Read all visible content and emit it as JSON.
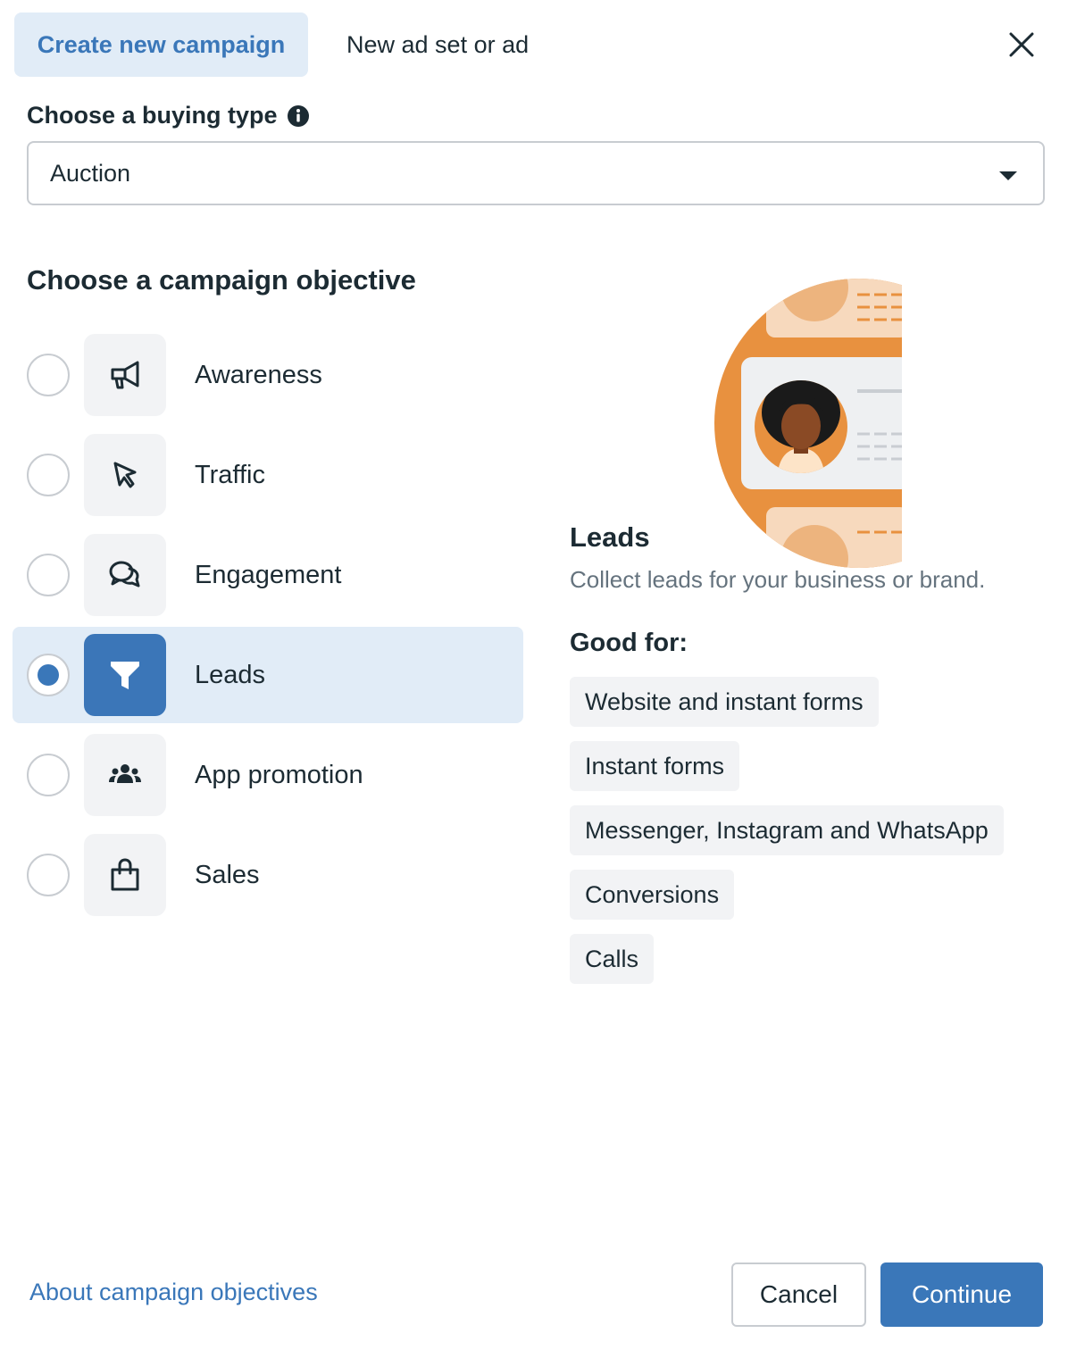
{
  "tabs": {
    "active": "Create new campaign",
    "inactive": "New ad set or ad"
  },
  "close_icon": "close-icon",
  "buying_type": {
    "label": "Choose a buying type",
    "info_icon": "info-icon",
    "selected": "Auction"
  },
  "objective": {
    "title": "Choose a campaign objective",
    "options": [
      {
        "label": "Awareness",
        "icon": "megaphone-icon",
        "selected": false
      },
      {
        "label": "Traffic",
        "icon": "cursor-icon",
        "selected": false
      },
      {
        "label": "Engagement",
        "icon": "chat-bubbles-icon",
        "selected": false
      },
      {
        "label": "Leads",
        "icon": "funnel-icon",
        "selected": true
      },
      {
        "label": "App promotion",
        "icon": "people-icon",
        "selected": false
      },
      {
        "label": "Sales",
        "icon": "shopping-bag-icon",
        "selected": false
      }
    ]
  },
  "detail": {
    "title": "Leads",
    "description": "Collect leads for your business or brand.",
    "good_for_label": "Good for:",
    "good_for": [
      "Website and instant forms",
      "Instant forms",
      "Messenger, Instagram and WhatsApp",
      "Conversions",
      "Calls"
    ]
  },
  "footer": {
    "about_link": "About campaign objectives",
    "cancel": "Cancel",
    "continue": "Continue"
  },
  "colors": {
    "accent": "#3a77b9",
    "selected_bg": "#e1ecf7",
    "chip_bg": "#f2f3f5",
    "illustration_orange": "#e8913f"
  }
}
